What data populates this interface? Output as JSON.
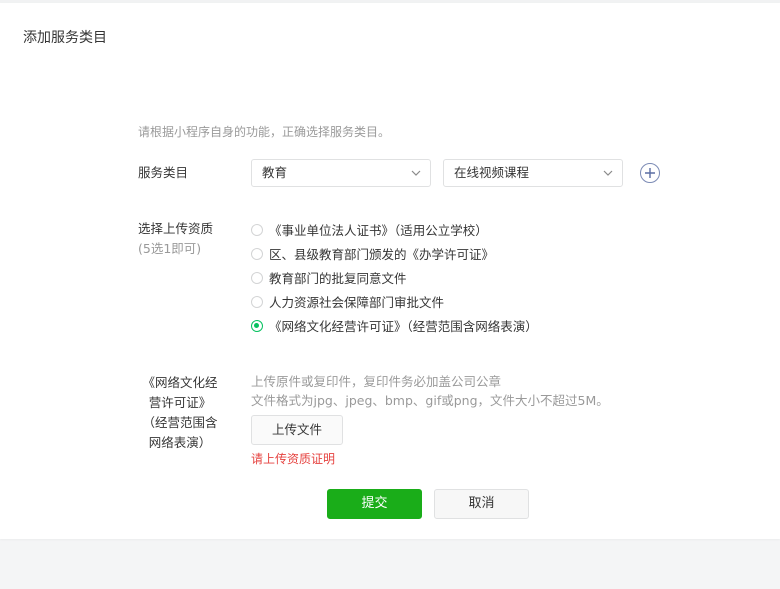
{
  "dialog": {
    "title": "添加服务类目"
  },
  "hint": "请根据小程序自身的功能，正确选择服务类目。",
  "category": {
    "label": "服务类目",
    "primary_value": "教育",
    "secondary_value": "在线视频课程"
  },
  "qualification": {
    "label": "选择上传资质",
    "sub_label": "(5选1即可)",
    "options": [
      {
        "label": "《事业单位法人证书》（适用公立学校）",
        "checked": false
      },
      {
        "label": "区、县级教育部门颁发的《办学许可证》",
        "checked": false
      },
      {
        "label": "教育部门的批复同意文件",
        "checked": false
      },
      {
        "label": "人力资源社会保障部门审批文件",
        "checked": false
      },
      {
        "label": "《网络文化经营许可证》（经营范围含网络表演）",
        "checked": true
      }
    ]
  },
  "upload": {
    "label_line1": "《网络文化经",
    "label_line2": "营许可证》",
    "label_line3": "（经营范围含",
    "label_line4": "网络表演）",
    "desc_line1": "上传原件或复印件，复印件务必加盖公司公章",
    "desc_line2": "文件格式为jpg、jpeg、bmp、gif或png，文件大小不超过5M。",
    "button_label": "上传文件",
    "error": "请上传资质证明"
  },
  "actions": {
    "submit": "提交",
    "cancel": "取消"
  },
  "colors": {
    "accent": "#1aad19",
    "radio_checked": "#07c160",
    "error": "#e64340",
    "muted": "#9a9a9a"
  }
}
